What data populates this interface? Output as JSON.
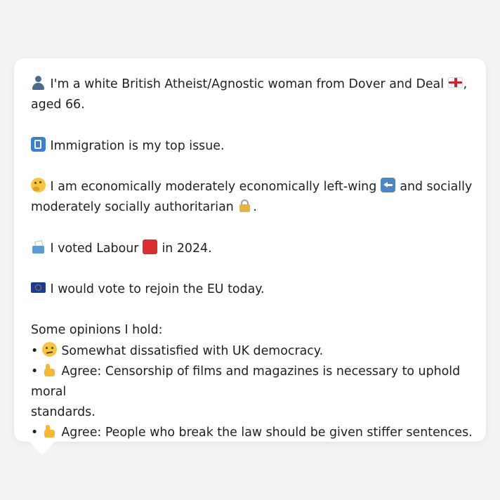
{
  "profile": {
    "intro": {
      "icon": "person-icon",
      "text_before": "I'm a white British Atheist/Agnostic woman from Dover and Deal",
      "flag_icon": "england-flag-icon",
      "text_after": ", aged 66."
    },
    "top_issue": {
      "icon": "passport-control-icon",
      "text": "Immigration is my top issue."
    },
    "ideology": {
      "icon": "thinking-face-icon",
      "text_before": "I am economically moderately economically left-wing",
      "economic_icon": "left-arrow-icon",
      "text_middle": "and socially moderately socially authoritarian",
      "social_icon": "lock-icon",
      "text_after": "."
    },
    "vote": {
      "icon": "ballot-box-icon",
      "text_before": "I voted Labour",
      "party_icon": "red-square-icon",
      "text_after": "in 2024."
    },
    "eu": {
      "icon": "eu-flag-icon",
      "text": "I would vote to rejoin the EU today."
    },
    "opinions": {
      "heading": "Some opinions I hold:",
      "bullet": "•",
      "items": [
        {
          "icon": "confused-face-icon",
          "text": "Somewhat dissatisfied with UK democracy."
        },
        {
          "icon": "thumbs-up-icon",
          "text_first_line": "Agree: Censorship of films and magazines is necessary to uphold moral",
          "text_second_line": "standards."
        },
        {
          "icon": "thumbs-up-icon",
          "text": "Agree: People who break the law should be given stiffer sentences."
        }
      ]
    }
  }
}
